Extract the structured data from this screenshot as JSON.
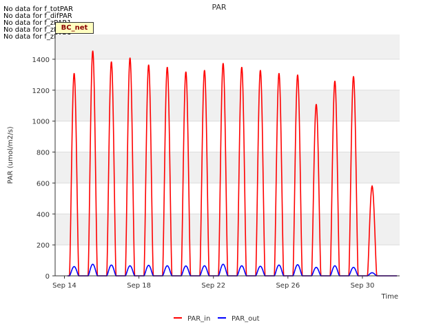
{
  "no_data_messages": [
    "No data for f_totPAR",
    "No data for f_difPAR",
    "No data for f_zPAR1",
    "No data for f_zPAR2",
    "No data for f_zPAR3"
  ],
  "site_badge": "BC_net",
  "chart_data": {
    "type": "line",
    "title": "PAR",
    "xlabel": "Time",
    "ylabel": "PAR (umol/m2/s)",
    "xlim": [
      "2016-09-13T12:00",
      "2016-10-02T00:00"
    ],
    "ylim": [
      0,
      1560
    ],
    "x_ticks": [
      "Sep 14",
      "Sep 18",
      "Sep 22",
      "Sep 26",
      "Sep 30"
    ],
    "y_ticks": [
      0,
      200,
      400,
      600,
      800,
      1000,
      1200,
      1400
    ],
    "grid": true,
    "legend_position": "bottom",
    "daily_peaks": {
      "dates": [
        "2016-09-14",
        "2016-09-15",
        "2016-09-16",
        "2016-09-17",
        "2016-09-18",
        "2016-09-19",
        "2016-09-20",
        "2016-09-21",
        "2016-09-22",
        "2016-09-23",
        "2016-09-24",
        "2016-09-25",
        "2016-09-26",
        "2016-09-27",
        "2016-09-28",
        "2016-09-29",
        "2016-09-30",
        "2016-10-01"
      ],
      "PAR_in": [
        1310,
        1455,
        1385,
        1410,
        1365,
        1350,
        1320,
        1330,
        1375,
        1350,
        1330,
        1310,
        1300,
        1110,
        1260,
        1290,
        580,
        0
      ],
      "PAR_out": [
        60,
        75,
        70,
        65,
        68,
        65,
        64,
        65,
        75,
        65,
        62,
        70,
        72,
        55,
        65,
        55,
        20,
        0
      ]
    },
    "series": [
      {
        "name": "PAR_in",
        "color": "#ff0000"
      },
      {
        "name": "PAR_out",
        "color": "#0000ff"
      }
    ]
  }
}
